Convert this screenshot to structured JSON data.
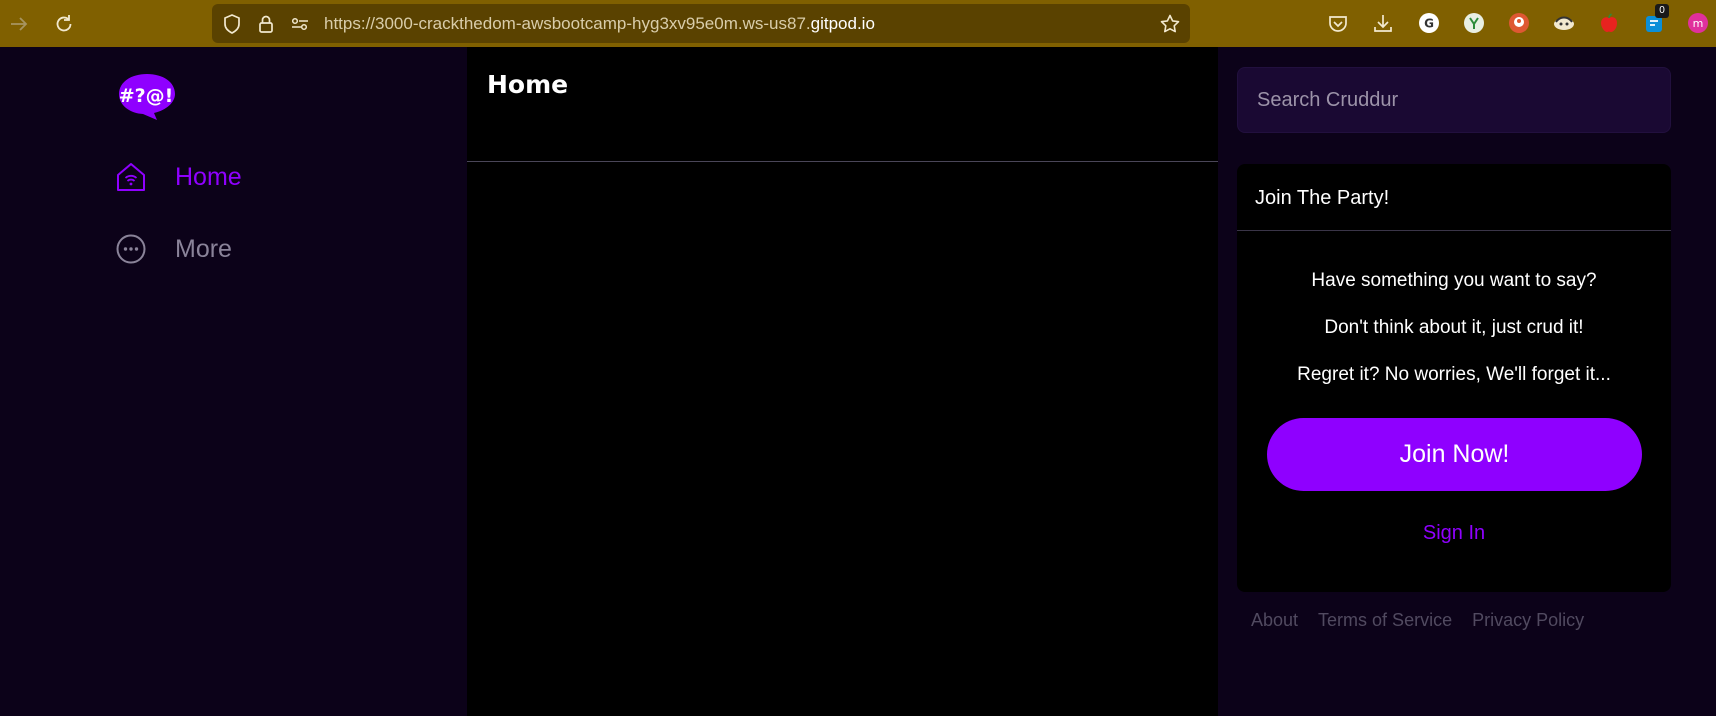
{
  "browser": {
    "url_prefix": "https://3000-crackthedom-awsbootcamp-hyg3xv95e0m.ws-us87.",
    "url_host": "gitpod.io",
    "toolbar_color": "#806000",
    "extension_badge": "0",
    "icons": [
      "arrow-right-icon",
      "reload-icon",
      "shield-icon",
      "lock-icon",
      "permissions-icon",
      "star-icon",
      "pocket-icon",
      "download-icon",
      "grammarly-icon",
      "extension-icon",
      "duckduckgo-icon",
      "extension-icon",
      "apple-icon",
      "extension-icon",
      "extension-icon"
    ]
  },
  "sidebar": {
    "logo_text": "#?@!",
    "items": [
      {
        "label": "Home",
        "icon": "home-icon",
        "active": true
      },
      {
        "label": "More",
        "icon": "more-icon",
        "active": false
      }
    ]
  },
  "main": {
    "title": "Home"
  },
  "search": {
    "placeholder": "Search Cruddur"
  },
  "join_card": {
    "title": "Join The Party!",
    "messages": [
      "Have something you want to say?",
      "Don't think about it, just crud it!",
      "Regret it? No worries, We'll forget it..."
    ],
    "join_label": "Join Now!",
    "signin_label": "Sign In"
  },
  "footer": {
    "links": [
      "About",
      "Terms of Service",
      "Privacy Policy"
    ]
  },
  "colors": {
    "accent": "#8f00ff",
    "page_bg": "#0c0219",
    "main_bg": "#000000"
  }
}
